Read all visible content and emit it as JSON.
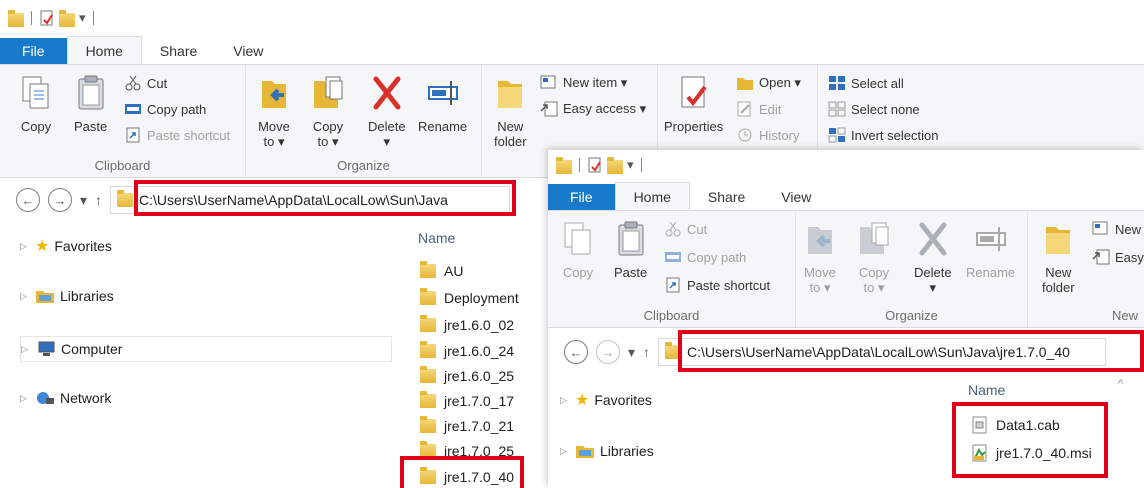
{
  "window1": {
    "qat_dropdown": "▾",
    "tabs": [
      "File",
      "Home",
      "Share",
      "View"
    ],
    "ribbon": {
      "clipboard": {
        "copy": "Copy",
        "paste": "Paste",
        "cut": "Cut",
        "copy_path": "Copy path",
        "paste_shortcut": "Paste shortcut",
        "label": "Clipboard"
      },
      "organize": {
        "move_to": "Move\nto ▾",
        "copy_to": "Copy\nto ▾",
        "delete": "Delete\n▾",
        "rename": "Rename",
        "label": "Organize"
      },
      "new": {
        "new_folder": "New\nfolder",
        "new_item": "New item ▾",
        "easy_access": "Easy access ▾"
      },
      "open": {
        "properties": "Properties",
        "open": "Open ▾",
        "edit": "Edit",
        "history": "History"
      },
      "select": {
        "select_all": "Select all",
        "select_none": "Select none",
        "invert_selection": "Invert selection"
      }
    },
    "nav": {
      "back": "←",
      "forward": "→",
      "recent": "▾",
      "up": "↑"
    },
    "address": "C:\\Users\\UserName\\AppData\\LocalLow\\Sun\\Java",
    "nav_pane": [
      "Favorites",
      "Libraries",
      "Computer",
      "Network"
    ],
    "column_name": "Name",
    "files": [
      "AU",
      "Deployment",
      "jre1.6.0_02",
      "jre1.6.0_24",
      "jre1.6.0_25",
      "jre1.7.0_17",
      "jre1.7.0_21",
      "jre1.7.0_25",
      "jre1.7.0_40"
    ]
  },
  "window2": {
    "qat_dropdown": "▾",
    "tabs": [
      "File",
      "Home",
      "Share",
      "View"
    ],
    "ribbon": {
      "clipboard": {
        "copy": "Copy",
        "paste": "Paste",
        "cut": "Cut",
        "copy_path": "Copy path",
        "paste_shortcut": "Paste shortcut",
        "label": "Clipboard"
      },
      "organize": {
        "move_to": "Move\nto ▾",
        "copy_to": "Copy\nto ▾",
        "delete": "Delete\n▾",
        "rename": "Rename",
        "label": "Organize"
      },
      "new": {
        "new_folder": "New\nfolder",
        "new_item": "New",
        "easy_access": "Easy",
        "label": "New"
      }
    },
    "nav": {
      "back": "←",
      "forward": "→",
      "recent": "▾",
      "up": "↑"
    },
    "address": "C:\\Users\\UserName\\AppData\\LocalLow\\Sun\\Java\\jre1.7.0_40",
    "nav_pane": [
      "Favorites",
      "Libraries"
    ],
    "column_name": "Name",
    "sort_indicator": "^",
    "files": [
      "Data1.cab",
      "jre1.7.0_40.msi"
    ]
  },
  "colors": {
    "file_tab": "#1979ca",
    "highlight": "#e0001b",
    "folder": "#e6b637"
  }
}
